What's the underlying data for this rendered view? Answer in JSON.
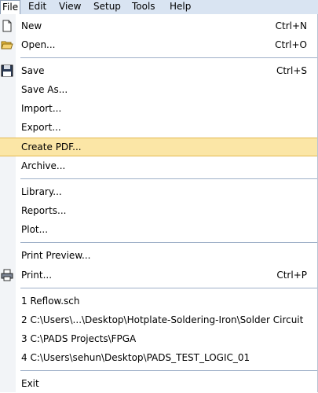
{
  "menubar": {
    "items": [
      {
        "label": "File"
      },
      {
        "label": "Edit"
      },
      {
        "label": "View"
      },
      {
        "label": "Setup"
      },
      {
        "label": "Tools"
      },
      {
        "label": "Help"
      }
    ]
  },
  "menu": {
    "new": {
      "label": "New",
      "shortcut": "Ctrl+N"
    },
    "open": {
      "label": "Open...",
      "shortcut": "Ctrl+O"
    },
    "save": {
      "label": "Save",
      "shortcut": "Ctrl+S"
    },
    "save_as": {
      "label": "Save As..."
    },
    "import": {
      "label": "Import..."
    },
    "export": {
      "label": "Export..."
    },
    "create_pdf": {
      "label": "Create PDF..."
    },
    "archive": {
      "label": "Archive..."
    },
    "library": {
      "label": "Library..."
    },
    "reports": {
      "label": "Reports..."
    },
    "plot": {
      "label": "Plot..."
    },
    "print_preview": {
      "label": "Print Preview..."
    },
    "print": {
      "label": "Print...",
      "shortcut": "Ctrl+P"
    },
    "recent": [
      {
        "label": "1 Reflow.sch"
      },
      {
        "label": "2 C:\\Users\\...\\Desktop\\Hotplate-Soldering-Iron\\Solder Circuit"
      },
      {
        "label": "3 C:\\PADS Projects\\FPGA"
      },
      {
        "label": "4 C:\\Users\\sehun\\Desktop\\PADS_TEST_LOGIC_01"
      }
    ],
    "exit": {
      "label": "Exit"
    }
  },
  "colors": {
    "menubar_bg": "#d9e4f2",
    "hover_bg": "#fbe6a6",
    "hover_border": "#e4b951",
    "separator": "#9fb0c8"
  },
  "icons": {
    "new": "new-document-icon",
    "open": "open-folder-icon",
    "save": "floppy-disk-icon",
    "print": "printer-icon"
  }
}
